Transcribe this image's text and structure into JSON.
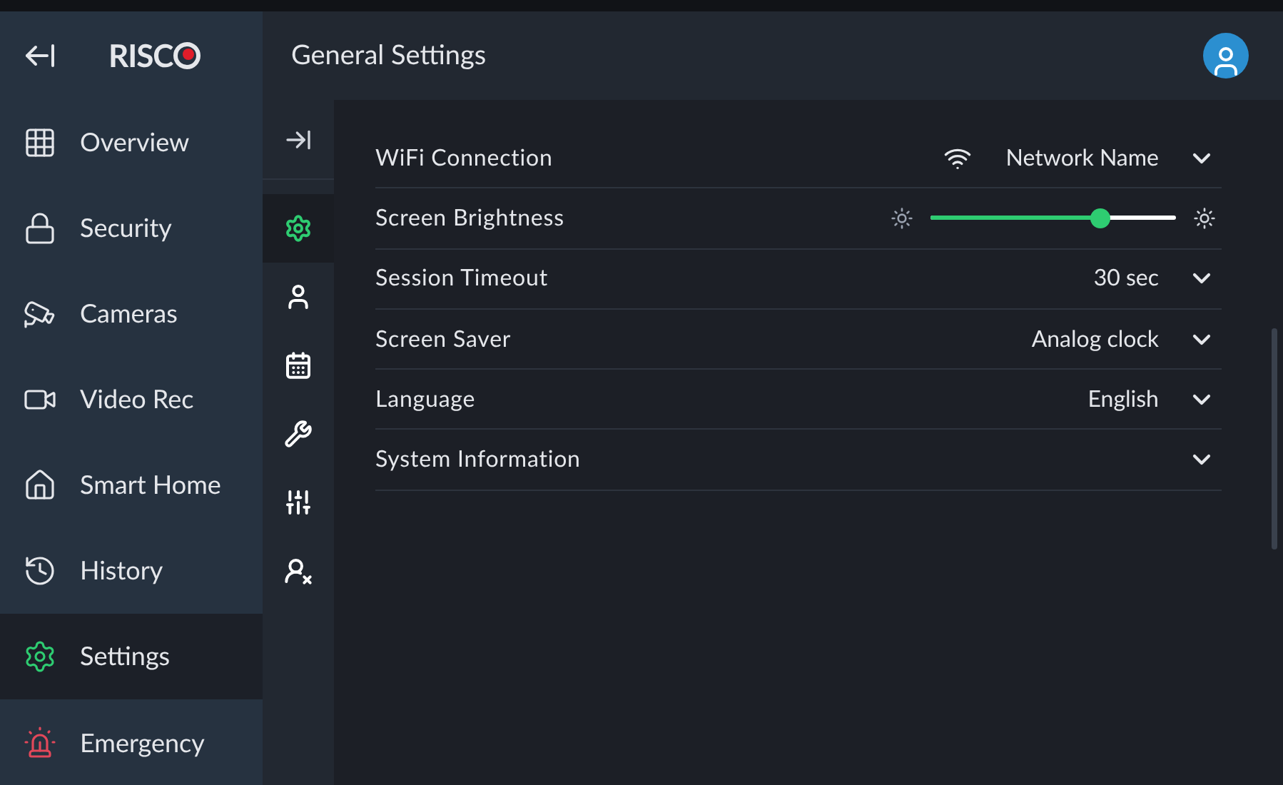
{
  "sidebar": {
    "logo": "RISC",
    "items": [
      {
        "kind": "overview",
        "label": "Overview",
        "selected": false
      },
      {
        "kind": "security",
        "label": "Security",
        "selected": false
      },
      {
        "kind": "cameras",
        "label": "Cameras",
        "selected": false
      },
      {
        "kind": "video",
        "label": "Video Rec",
        "selected": false
      },
      {
        "kind": "smarthome",
        "label": "Smart Home",
        "selected": false
      },
      {
        "kind": "history",
        "label": "History",
        "selected": false
      },
      {
        "kind": "settings",
        "label": "Settings",
        "selected": true
      },
      {
        "kind": "emergency",
        "label": "Emergency",
        "selected": false
      }
    ]
  },
  "header": {
    "title": "General Settings"
  },
  "subnav": [
    {
      "kind": "general",
      "selected": true
    },
    {
      "kind": "user",
      "selected": false
    },
    {
      "kind": "calendar",
      "selected": false
    },
    {
      "kind": "tools",
      "selected": false
    },
    {
      "kind": "mixer",
      "selected": false
    },
    {
      "kind": "userexit",
      "selected": false
    }
  ],
  "settings": [
    {
      "kind": "wifi",
      "label": "WiFi Connection",
      "value": "Network Name"
    },
    {
      "kind": "slider",
      "label": "Screen Brightness",
      "level": 0.69
    },
    {
      "kind": "select",
      "label": "Session Timeout",
      "value": "30 sec"
    },
    {
      "kind": "select",
      "label": "Screen Saver",
      "value": "Analog clock"
    },
    {
      "kind": "select",
      "label": "Language",
      "value": "English"
    },
    {
      "kind": "expander",
      "label": "System Information"
    }
  ]
}
